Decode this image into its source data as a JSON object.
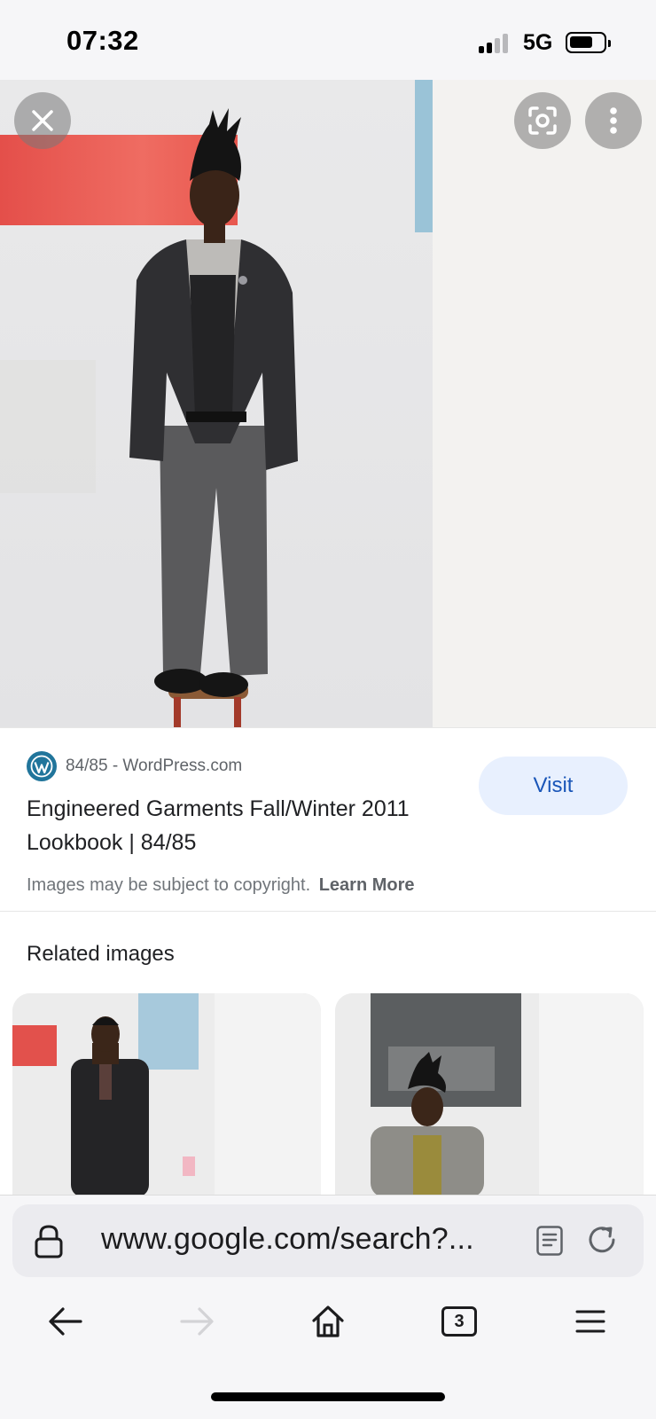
{
  "status_bar": {
    "time": "07:32",
    "network": "5G",
    "signal_icon": "signal-bars-icon",
    "battery_icon": "battery-icon"
  },
  "image_viewer": {
    "close_icon": "close-icon",
    "lens_icon": "lens-search-icon",
    "more_icon": "more-vertical-icon"
  },
  "result": {
    "source_icon": "wordpress-logo-icon",
    "source": "84/85 - WordPress.com",
    "title": "Engineered Garments Fall/Winter 2011 Lookbook | 84/85",
    "visit_label": "Visit",
    "copyright_text": "Images may be subject to copyright.",
    "learn_more": "Learn More"
  },
  "related": {
    "heading": "Related images",
    "items": [
      {
        "name": "related-image-1"
      },
      {
        "name": "related-image-2"
      }
    ]
  },
  "address_bar": {
    "lock_icon": "lock-icon",
    "url": "www.google.com/search?...",
    "reader_icon": "reader-mode-icon",
    "reload_icon": "reload-icon"
  },
  "toolbar": {
    "back_icon": "back-arrow-icon",
    "forward_icon": "forward-arrow-icon",
    "home_icon": "home-icon",
    "tab_count": "3",
    "menu_icon": "hamburger-menu-icon"
  },
  "colors": {
    "visit_bg": "#e8f0fe",
    "visit_text": "#1a56b8",
    "wordpress_blue": "#21759b"
  }
}
